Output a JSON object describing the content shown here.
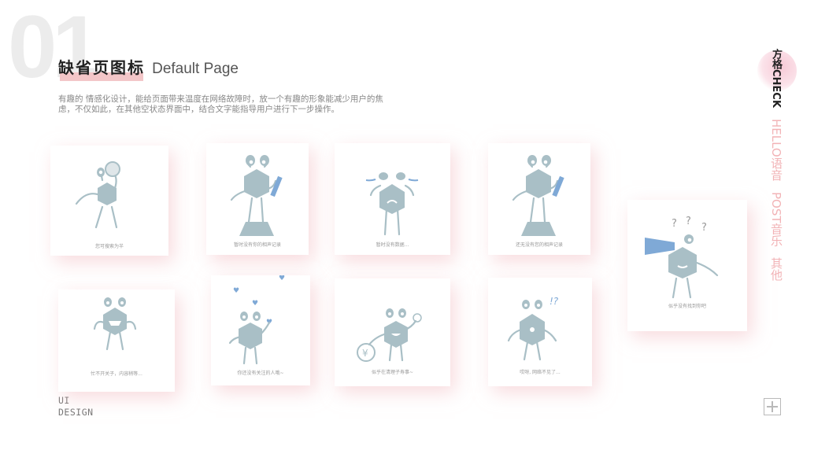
{
  "page_number": "01",
  "title": {
    "cn": "缺省页图标",
    "en": "Default Page"
  },
  "description": "有趣的 情感化设计，能给页面带来温度在网络故障时，放一个有趣的形象能减少用户的焦虑，不仅如此，在其他空状态界面中，结合文字能指导用户进行下一步操作。",
  "cards": [
    {
      "caption": "您可搜索为半",
      "icon": "magnifier-monster-icon"
    },
    {
      "caption": "暂时没有你的相声记录",
      "icon": "pencil-monster-on-pedestal-icon"
    },
    {
      "caption": "暂时没有数据...",
      "icon": "crying-monster-icon"
    },
    {
      "caption": "还无没有您的相声记录",
      "icon": "pencil-monster-on-pedestal-icon"
    },
    {
      "caption": "似乎没有找到你吧",
      "icon": "telescope-monster-icon"
    },
    {
      "caption": "忙不开关子，内容稍等...",
      "icon": "grinning-monster-icon"
    },
    {
      "caption": "你还没有关注的人哦~",
      "icon": "heart-monster-icon"
    },
    {
      "caption": "似乎在清理子寿事~",
      "icon": "coin-monster-icon"
    },
    {
      "caption": "哎呀, 网络不见了...",
      "icon": "confused-monster-icon"
    }
  ],
  "bottom_label": {
    "line1": "UI",
    "line2": "DESIGN"
  },
  "nav": [
    {
      "label": "方格CHECK",
      "active": true
    },
    {
      "label": "HELLO语音",
      "active": false
    },
    {
      "label": "POST音乐",
      "active": false
    },
    {
      "label": "其他",
      "active": false
    }
  ],
  "colors": {
    "accent_pink": "#f2b3b6",
    "monster_blue": "#a9bfc6",
    "pen_blue": "#7fa9d6",
    "highlight": "#f3c6c8"
  }
}
